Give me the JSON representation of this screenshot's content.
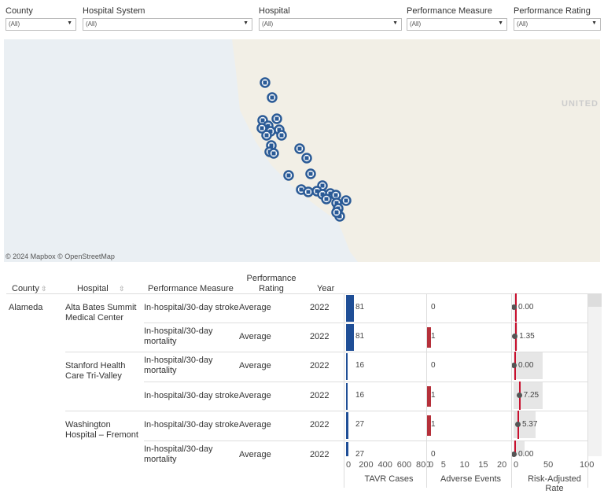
{
  "filters": [
    {
      "label": "County",
      "value": "(All)"
    },
    {
      "label": "Hospital System",
      "value": "(All)"
    },
    {
      "label": "Hospital",
      "value": "(All)"
    },
    {
      "label": "Performance Measure",
      "value": "(All)"
    },
    {
      "label": "Performance Rating",
      "value": "(All)"
    }
  ],
  "map": {
    "attribution": "© 2024 Mapbox  © OpenStreetMap",
    "country_label": "UNITED",
    "marker_color": "#2a5a96",
    "land_color": "#f2efe6",
    "water_color": "#eaeff3"
  },
  "table": {
    "headers": {
      "county": "County",
      "hospital": "Hospital",
      "measure": "Performance Measure",
      "rating": "Performance Rating",
      "year": "Year"
    },
    "axes": [
      {
        "title": "TAVR Cases",
        "ticks": [
          "0",
          "200",
          "400",
          "600",
          "800"
        ],
        "range": [
          0,
          800
        ],
        "color": "#1f4e96"
      },
      {
        "title": "Adverse Events",
        "ticks": [
          "0",
          "5",
          "10",
          "15",
          "20"
        ],
        "range": [
          0,
          20
        ],
        "color": "#b5303a"
      },
      {
        "title": "Risk-Adjusted Rate",
        "ticks": [
          "0",
          "50",
          "100"
        ],
        "range": [
          0,
          100
        ],
        "color": "#c8102e"
      }
    ],
    "rows": [
      {
        "county": "Alameda",
        "hospital": "Alta Bates Summit Medical Center",
        "measure": "In-hospital/30-day stroke",
        "rating": "Average",
        "year": "2022",
        "cases": 81,
        "cases_label": "81",
        "events": 0,
        "events_label": "0",
        "rate": 0.0,
        "rate_label": "0.00",
        "ci_upper": 3,
        "reference": 2
      },
      {
        "county": "",
        "hospital": "",
        "measure": "In-hospital/30-day mortality",
        "rating": "Average",
        "year": "2022",
        "cases": 81,
        "cases_label": "81",
        "events": 1,
        "events_label": "1",
        "rate": 1.35,
        "rate_label": "1.35",
        "ci_upper": 5,
        "reference": 2
      },
      {
        "county": "",
        "hospital": "Stanford Health Care Tri-Valley",
        "measure": "In-hospital/30-day mortality",
        "rating": "Average",
        "year": "2022",
        "cases": 16,
        "cases_label": "16",
        "events": 0,
        "events_label": "0",
        "rate": 0.0,
        "rate_label": "0.00",
        "ci_upper": 40,
        "reference": 1.5
      },
      {
        "county": "",
        "hospital": "",
        "measure": "In-hospital/30-day stroke",
        "rating": "Average",
        "year": "2022",
        "cases": 16,
        "cases_label": "16",
        "events": 1,
        "events_label": "1",
        "rate": 7.25,
        "rate_label": "7.25",
        "ci_upper": 40,
        "reference": 8
      },
      {
        "county": "",
        "hospital": "Washington Hospital – Fremont",
        "measure": "In-hospital/30-day stroke",
        "rating": "Average",
        "year": "2022",
        "cases": 27,
        "cases_label": "27",
        "events": 1,
        "events_label": "1",
        "rate": 5.37,
        "rate_label": "5.37",
        "ci_upper": 30,
        "reference": 5
      },
      {
        "county": "",
        "hospital": "",
        "measure": "In-hospital/30-day mortality",
        "rating": "Average",
        "year": "2022",
        "cases": 27,
        "cases_label": "27",
        "events": 0,
        "events_label": "0",
        "rate": 0.0,
        "rate_label": "0.00",
        "ci_upper": 15,
        "reference": 1.5
      }
    ]
  }
}
